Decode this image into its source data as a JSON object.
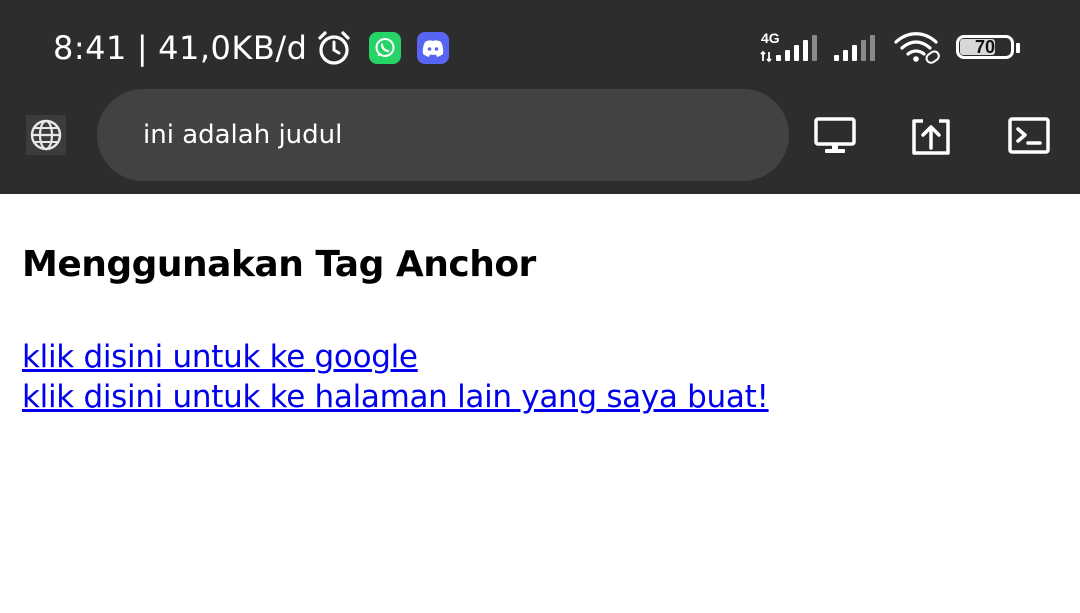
{
  "status_bar": {
    "time": "8:41",
    "separator": "|",
    "net_speed": "41,0KB/d",
    "network_type": "4G",
    "battery_level": "70",
    "icons": [
      "alarm-icon",
      "whatsapp-icon",
      "discord-icon",
      "signal-icon",
      "wifi-icon",
      "battery-icon"
    ]
  },
  "browser": {
    "url": "ini adalah judul",
    "icons": [
      "globe-icon",
      "desktop-icon",
      "share-icon",
      "console-icon"
    ]
  },
  "page": {
    "heading": "Menggunakan Tag Anchor",
    "links": [
      {
        "text": "klik disini untuk ke google"
      },
      {
        "text": "klik disini untuk ke halaman lain yang saya buat!"
      }
    ]
  },
  "colors": {
    "bar_bg": "#2d2d2d",
    "url_bg": "#424242",
    "link": "#0000ee",
    "whatsapp": "#25d366",
    "discord": "#5865f2"
  }
}
